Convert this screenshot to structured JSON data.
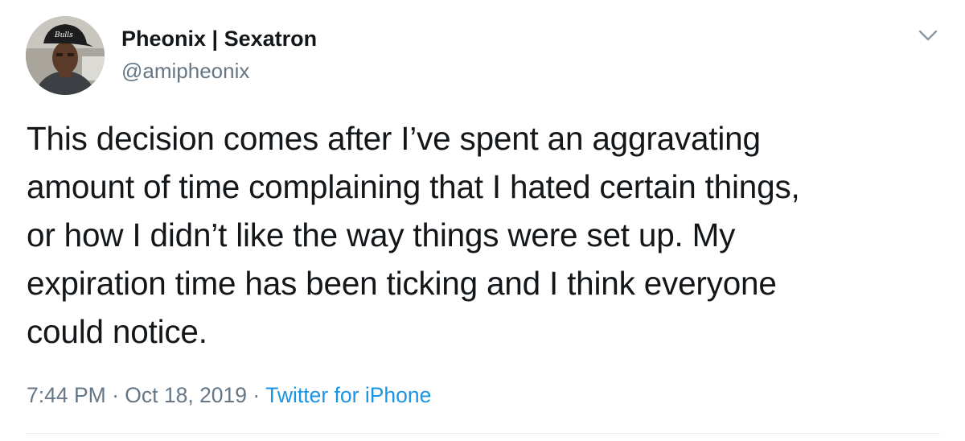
{
  "user": {
    "display_name": "Pheonix | Sexatron",
    "handle": "@amipheonix",
    "avatar_hat_text": "Bulls"
  },
  "tweet": {
    "text_lines": [
      "This decision comes after I’ve spent an aggravating",
      "amount of time complaining that I hated certain things,",
      "or how I didn’t like the way things were set up. My",
      "expiration time has been ticking and I think everyone",
      "could notice."
    ],
    "time": "7:44 PM",
    "date": "Oct 18, 2019",
    "separator": "·",
    "source": "Twitter for iPhone"
  },
  "icons": {
    "menu": "chevron-down-icon"
  },
  "colors": {
    "text": "#14171a",
    "secondary": "#657786",
    "link": "#1b95e0",
    "divider": "#e6ecf0"
  }
}
